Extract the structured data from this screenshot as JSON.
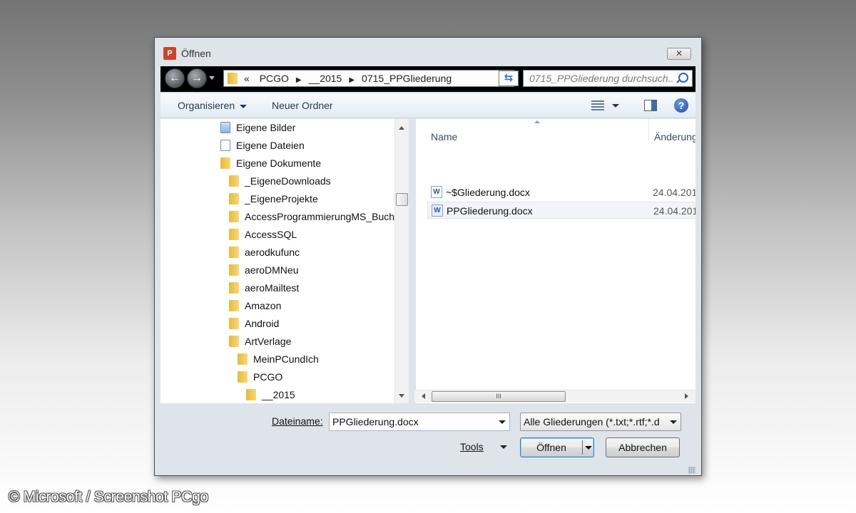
{
  "window": {
    "title": "Öffnen",
    "app_icon_letter": "P",
    "close_glyph": "✕"
  },
  "nav": {
    "back_glyph": "←",
    "forward_glyph": "→",
    "breadcrumb_prefix": "«",
    "breadcrumbs": [
      "PCGO",
      "__2015",
      "0715_PPGliederung"
    ],
    "search_placeholder": "0715_PPGliederung durchsuch..."
  },
  "toolbar": {
    "organize_label": "Organisieren",
    "new_folder_label": "Neuer Ordner",
    "help_glyph": "?"
  },
  "tree": {
    "items": [
      {
        "label": "Eigene Bilder"
      },
      {
        "label": "Eigene Dateien"
      },
      {
        "label": "Eigene Dokumente"
      },
      {
        "label": "_EigeneDownloads"
      },
      {
        "label": "_EigeneProjekte"
      },
      {
        "label": "AccessProgrammierungMS_Buch"
      },
      {
        "label": "AccessSQL"
      },
      {
        "label": "aerodkufunc"
      },
      {
        "label": "aeroDMNeu"
      },
      {
        "label": "aeroMailtest"
      },
      {
        "label": "Amazon"
      },
      {
        "label": "Android"
      },
      {
        "label": "ArtVerlage"
      },
      {
        "label": "MeinPCundIch"
      },
      {
        "label": "PCGO"
      },
      {
        "label": "__2015"
      }
    ]
  },
  "files": {
    "columns": {
      "name": "Name",
      "modified": "Änderung"
    },
    "rows": [
      {
        "name": "~$Gliederung.docx",
        "date": "24.04.201",
        "selected": false
      },
      {
        "name": "PPGliederung.docx",
        "date": "24.04.201",
        "selected": true
      }
    ],
    "hscroll_grip": "III"
  },
  "footer": {
    "filename_label": "Dateiname:",
    "filename_value": "PPGliederung.docx",
    "filter_value": "Alle Gliederungen (*.txt;*.rtf;*.d",
    "tools_label": "Tools",
    "open_label": "Öffnen",
    "cancel_label": "Abbrechen"
  },
  "copyright": "© Microsoft / Screenshot PCgo"
}
